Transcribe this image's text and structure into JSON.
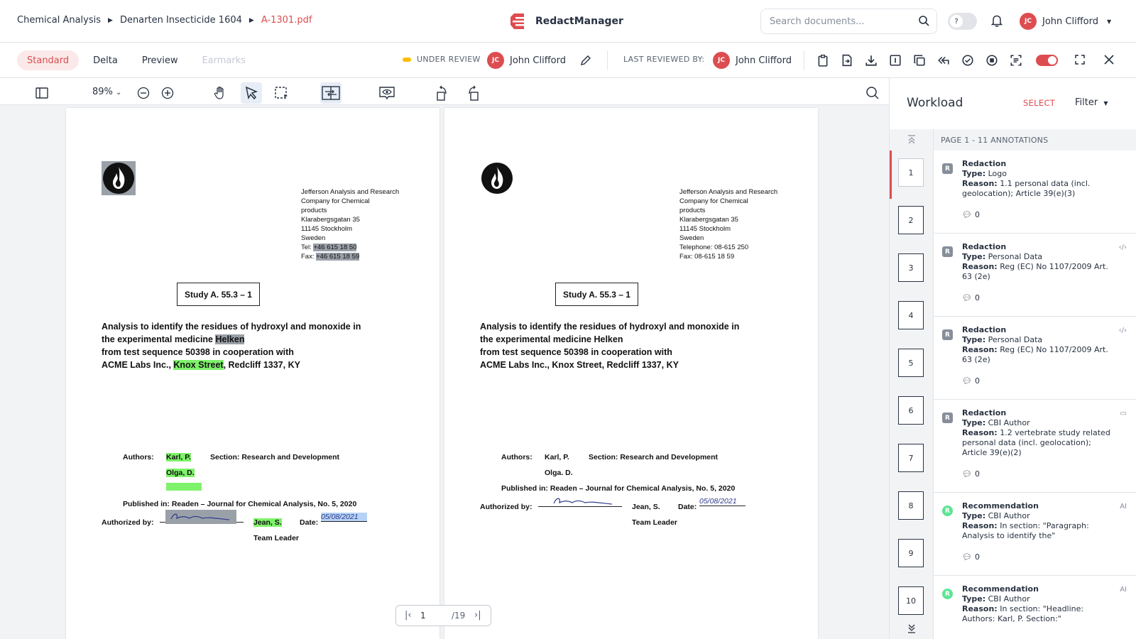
{
  "breadcrumb": {
    "items": [
      "Chemical Analysis",
      "Denarten Insecticide 1604",
      "A-1301.pdf"
    ]
  },
  "app": {
    "name": "RedactManager"
  },
  "search": {
    "placeholder": "Search documents..."
  },
  "user": {
    "name": "John Clifford",
    "initials": "JC"
  },
  "modes": [
    "Standard",
    "Delta",
    "Preview",
    "Earmarks"
  ],
  "status": {
    "label": "UNDER REVIEW",
    "color": "#fdbd00"
  },
  "assignee": {
    "name": "John Clifford",
    "initials": "JC"
  },
  "last_reviewed": {
    "label": "LAST REVIEWED BY:",
    "name": "John Clifford",
    "initials": "JC"
  },
  "toolbar": {
    "zoom": "89%"
  },
  "doc": {
    "address": [
      "Jefferson Analysis and Research",
      "Company for Chemical",
      "products",
      "Klarabergsgatan 35",
      "11145 Stockholm",
      "Sweden"
    ],
    "tel_label": "Tel:",
    "tel": "+46 615 18 50",
    "fax_label": "Fax:",
    "fax": "+46 615 18 59",
    "tel2": "Telephone: 08-615 250",
    "fax2": "Fax: 08-615 18 59",
    "study": "Study A. 55.3 – 1",
    "title_lines": [
      "Analysis to identify the residues of hydroxyl and monoxide in",
      "the experimental medicine ",
      "from test sequence 50398 in cooperation with",
      "ACME Labs Inc., "
    ],
    "medicine": "Helken",
    "street": "Knox Street",
    "city_suffix": ", Redcliff 1337, KY",
    "authors_label": "Authors:",
    "author1": "Karl, P.",
    "author2": "Olga, D.",
    "author2b": "Olga. D.",
    "section": "Section: Research and Development",
    "published": "Published in: Readen – Journal for Chemical Analysis, No. 5, 2020",
    "authorized_label": "Authorized by:",
    "signer": "Jean, S.",
    "date_label": "Date:",
    "date_value": "05/08/2021",
    "team_leader": "Team Leader"
  },
  "pager": {
    "current": "1",
    "total": "/19"
  },
  "workload": {
    "title": "Workload",
    "select": "SELECT",
    "filter": "Filter",
    "page_header": "PAGE 1 - 11 ANNOTATIONS"
  },
  "thumbnails": [
    "1",
    "2",
    "3",
    "4",
    "5",
    "6",
    "7",
    "8",
    "9",
    "10"
  ],
  "annotations": [
    {
      "badge": "R",
      "title": "Redaction",
      "type": "Logo",
      "reason": "1.1 personal data (incl. geolocation); Article 39(e)(3)",
      "comments": "0",
      "corner": ""
    },
    {
      "badge": "R",
      "title": "Redaction",
      "type": "Personal Data",
      "reason": "Reg (EC) No 1107/2009 Art. 63 (2e)",
      "comments": "0",
      "corner": "‹/›"
    },
    {
      "badge": "R",
      "title": "Redaction",
      "type": "Personal Data",
      "reason": "Reg (EC) No 1107/2009 Art. 63 (2e)",
      "comments": "0",
      "corner": "‹/›"
    },
    {
      "badge": "R",
      "title": "Redaction",
      "type": "CBI Author",
      "reason": "1.2 vertebrate study related personal data (incl. geolocation); Article 39(e)(2)",
      "comments": "0",
      "corner": "▭"
    },
    {
      "badge": "R",
      "title": "Recommendation",
      "type": "CBI Author",
      "reason": "In section: \"Paragraph: Analysis to identify the\"",
      "comments": "0",
      "corner": "AI"
    },
    {
      "badge": "R",
      "title": "Recommendation",
      "type": "CBI Author",
      "reason": "In section: \"Headline: Authors: Karl, P. Section:\"",
      "comments": "",
      "corner": "AI"
    }
  ],
  "labels": {
    "type": "Type:",
    "reason": "Reason:"
  }
}
